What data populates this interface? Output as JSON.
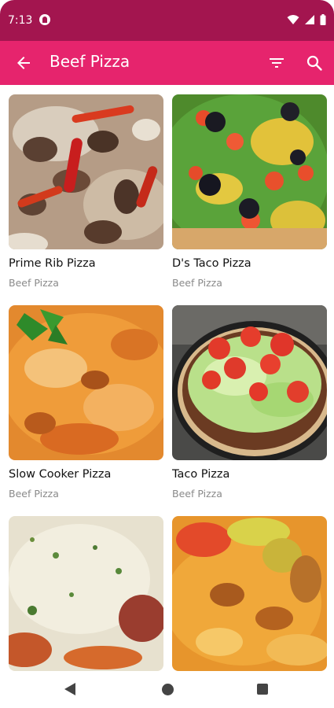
{
  "status": {
    "time": "7:13"
  },
  "app_bar": {
    "title": "Beef Pizza"
  },
  "recipes": [
    {
      "title": "Prime Rib Pizza",
      "category": "Beef Pizza"
    },
    {
      "title": "D's Taco Pizza",
      "category": "Beef Pizza"
    },
    {
      "title": "Slow Cooker Pizza",
      "category": "Beef Pizza"
    },
    {
      "title": "Taco Pizza",
      "category": "Beef Pizza"
    },
    {
      "title": "",
      "category": ""
    },
    {
      "title": "",
      "category": ""
    }
  ],
  "colors": {
    "status_bar": "#a3154f",
    "app_bar": "#e6246d"
  }
}
